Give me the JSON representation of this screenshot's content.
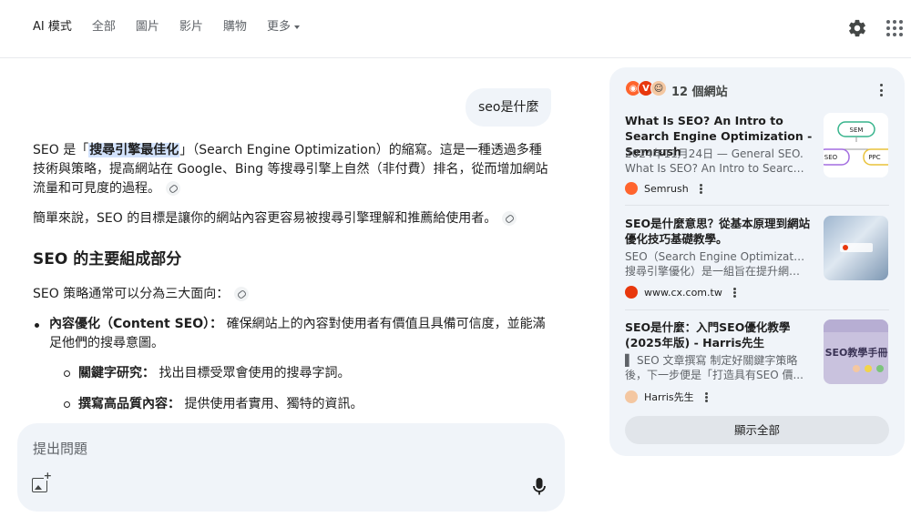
{
  "nav": {
    "tabs": [
      {
        "label": "AI 模式",
        "active": true
      },
      {
        "label": "全部"
      },
      {
        "label": "圖片"
      },
      {
        "label": "影片"
      },
      {
        "label": "購物"
      },
      {
        "label": "更多"
      }
    ],
    "settings_icon": "gear-icon",
    "apps_icon": "apps-grid-icon"
  },
  "chat": {
    "user_query": "seo是什麼",
    "p1_before": "SEO 是「",
    "p1_highlight": "搜尋引擎最佳化",
    "p1_after": "」（Search Engine Optimization）的縮寫。這是一種透過多種技術與策略，提高網站在 Google、Bing 等搜尋引擎上自然（非付費）排名，從而增加網站流量和可見度的過程。",
    "p2": "簡單來說，SEO 的目標是讓你的網站內容更容易被搜尋引擎理解和推薦給使用者。",
    "heading": "SEO 的主要組成部分",
    "p3": "SEO 策略通常可以分為三大面向：",
    "bullet1_label": "內容優化（Content SEO）：",
    "bullet1_text": " 確保網站上的內容對使用者有價值且具備可信度，並能滿足他們的搜尋意圖。",
    "sub1_label": "關鍵字研究：",
    "sub1_text": " 找出目標受眾會使用的搜尋字詞。",
    "sub2_label": "撰寫高品質內容：",
    "sub2_text": " 提供使用者實用、獨特的資訊。"
  },
  "input": {
    "placeholder": "提出問題"
  },
  "sources": {
    "count_label": "12 個網站",
    "cards": [
      {
        "title": "What Is SEO? An Intro to Search Engine Optimization - Semrush",
        "snippet_line1": "2024年11月24日 — General SEO.",
        "snippet_line2": "What Is SEO? An Intro to Search...",
        "source": "Semrush",
        "fav_color": "#ff642d"
      },
      {
        "title": "SEO是什麼意思？從基本原理到網站優化技巧基礎教學。",
        "snippet_line1": "SEO（Search Engine Optimization，",
        "snippet_line2": "搜尋引擎優化）是一組旨在提升網站...",
        "source": "www.cx.com.tw",
        "fav_color": "#e8380d"
      },
      {
        "title": "SEO是什麼：入門SEO優化教學(2025年版) - Harris先生",
        "snippet_line1": "▌ SEO 文章撰寫 制定好關鍵字策略",
        "snippet_line2": "後，下一步便是「打造具有SEO 價...",
        "source": "Harris先生",
        "fav_color": "#f4c7a1"
      }
    ],
    "thumb1": {
      "tag1": "SEM",
      "tag2": "SEO",
      "tag3": "PPC"
    },
    "thumb3": {
      "text": "SEO教學手冊"
    },
    "show_all": "顯示全部"
  }
}
